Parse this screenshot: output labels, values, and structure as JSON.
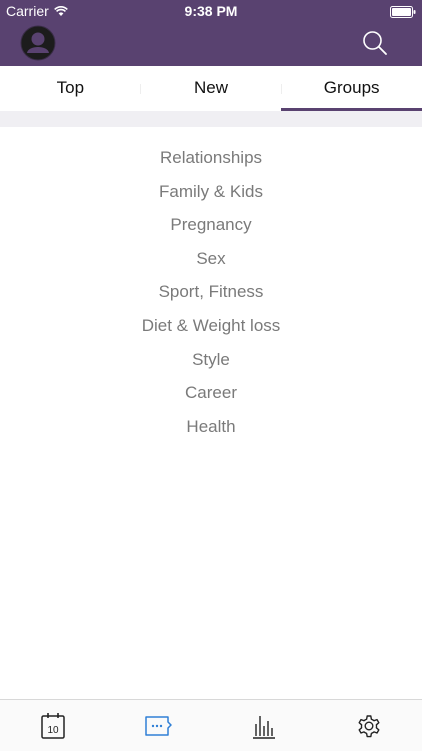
{
  "status_bar": {
    "carrier": "Carrier",
    "time": "9:38 PM"
  },
  "header": {
    "avatar_icon": "user-avatar-icon",
    "search_icon": "search-icon",
    "background_color": "#594270"
  },
  "tabs": [
    {
      "label": "Top",
      "active": false
    },
    {
      "label": "New",
      "active": false
    },
    {
      "label": "Groups",
      "active": true
    }
  ],
  "groups": [
    {
      "label": "Relationships"
    },
    {
      "label": "Family & Kids"
    },
    {
      "label": "Pregnancy"
    },
    {
      "label": "Sex"
    },
    {
      "label": "Sport, Fitness"
    },
    {
      "label": "Diet & Weight loss"
    },
    {
      "label": "Style"
    },
    {
      "label": "Career"
    },
    {
      "label": "Health"
    }
  ],
  "tabbar": {
    "calendar_day": "10",
    "items": [
      {
        "icon": "calendar-icon",
        "active": false
      },
      {
        "icon": "chat-icon",
        "active": true
      },
      {
        "icon": "stats-icon",
        "active": false
      },
      {
        "icon": "gear-icon",
        "active": false
      }
    ],
    "active_color": "#2f7fd6"
  }
}
